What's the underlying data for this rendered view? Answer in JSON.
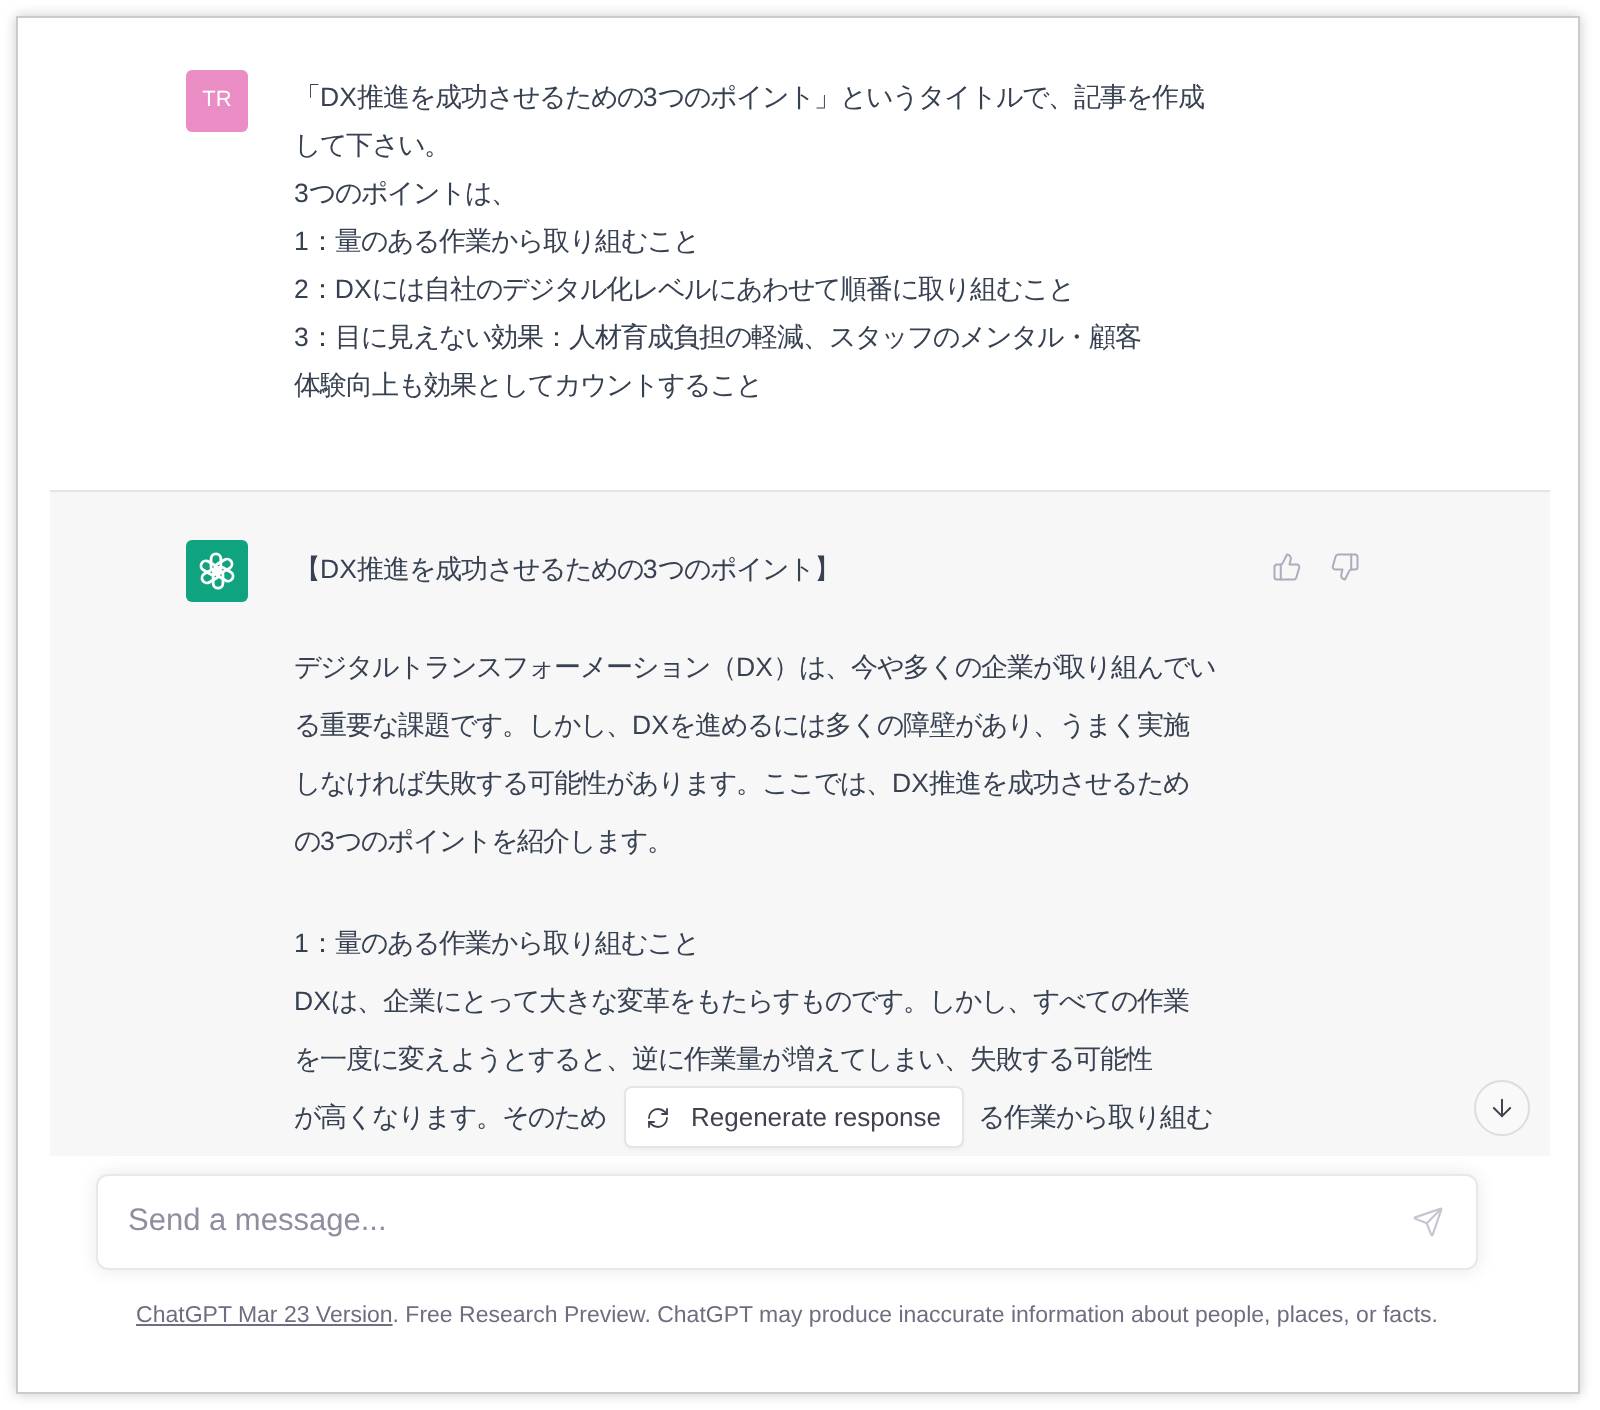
{
  "user_message": {
    "avatar": "TR",
    "lines": [
      "「DX推進を成功させるための3つのポイント」というタイトルで、記事を作成",
      "して下さい。",
      "3つのポイントは、",
      "1：量のある作業から取り組むこと",
      "2：DXには自社のデジタル化レベルにあわせて順番に取り組むこと",
      "3：目に見えない効果：人材育成負担の軽減、スタッフのメンタル・顧客",
      "体験向上も効果としてカウントすること"
    ]
  },
  "assistant_message": {
    "title": "【DX推進を成功させるための3つのポイント】",
    "paragraphs": [
      {
        "lines": [
          [
            "デジタルトランスフォーメーション（DX）は、今や多くの企業が取り組んでい"
          ],
          [
            "る重要な課題です。しかし、DXを進めるには多くの障壁があり、うまく実施"
          ],
          [
            "しなければ失敗する可能性があります。ここでは、DX推進を成功させるため"
          ],
          [
            "の3つのポイントを紹介します。"
          ]
        ]
      },
      {
        "lines": [
          [
            "1：量のある作業から取り組むこと"
          ],
          [
            "DXは、企業にとって大きな変革をもたらすものです。しかし、すべての作業"
          ],
          [
            "を一度に変えようとすると、逆に作業量が増えてしまい、失敗する可能性"
          ],
          [
            "が高くなります。そのため",
            "る作業から取り組む"
          ]
        ]
      }
    ]
  },
  "regenerate_button": {
    "label": "Regenerate response"
  },
  "composer": {
    "placeholder": "Send a message..."
  },
  "footer": {
    "link": "ChatGPT Mar 23 Version",
    "text": ". Free Research Preview. ChatGPT may produce inaccurate information about people, places, or facts."
  }
}
